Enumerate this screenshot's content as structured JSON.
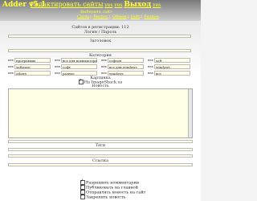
{
  "header": {
    "logo": "Adder v5.1",
    "nav_edit": "Редактировать сайты",
    "nav_yes1": "yes",
    "nav_yes2": "yes",
    "nav_exit": "Выход",
    "nav_yes3": "yes",
    "hint": "Выберите сайт",
    "sub": [
      "Cards",
      "Веспос",
      "Обмен",
      "Dofs",
      "Разное"
    ]
  },
  "form": {
    "site_count": "Сайтов в регистрации: 112",
    "links_label": "Логин / Пароль",
    "title_label": "Заголовок",
    "categories_label": "Категория",
    "categories": [
      [
        "программы",
        "все для компьютера",
        "софтон",
        "soft"
      ],
      [
        "software",
        "софт",
        "все для windows",
        "windows"
      ],
      [
        "others",
        "разное",
        "windows",
        "все"
      ]
    ],
    "check_mark": "ввв",
    "image_label": "Картинка",
    "image_checkbox": "На ImageShack.us",
    "news_label": "Новость",
    "tags_label": "Теги",
    "source_label": "Ссылка",
    "options": [
      "Разрешить комментарии",
      "Публиковать на главной",
      "Отправлять новость на сайт",
      "Закрепить новость"
    ]
  }
}
